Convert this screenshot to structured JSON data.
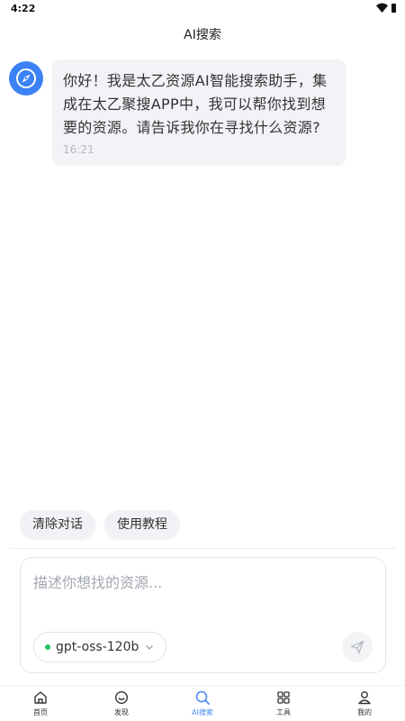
{
  "status": {
    "time": "4:22"
  },
  "header": {
    "title": "AI搜索"
  },
  "chat": {
    "messages": [
      {
        "role": "assistant",
        "text": "你好！我是太乙资源AI智能搜索助手，集成在太乙聚搜APP中，我可以帮你找到想要的资源。请告诉我你在寻找什么资源?",
        "time": "16:21"
      }
    ]
  },
  "quick_actions": [
    {
      "label": "清除对话"
    },
    {
      "label": "使用教程"
    }
  ],
  "composer": {
    "placeholder": "描述你想找的资源...",
    "value": "",
    "model": "gpt-oss-120b"
  },
  "tabs": [
    {
      "label": "首页",
      "icon": "home-icon",
      "active": false
    },
    {
      "label": "发现",
      "icon": "discover-icon",
      "active": false
    },
    {
      "label": "AI搜索",
      "icon": "search-icon",
      "active": true
    },
    {
      "label": "工具",
      "icon": "tools-icon",
      "active": false
    },
    {
      "label": "我的",
      "icon": "profile-icon",
      "active": false
    }
  ],
  "colors": {
    "accent": "#4a8af4",
    "avatar": "#3b82f6",
    "model_dot": "#22c55e"
  }
}
